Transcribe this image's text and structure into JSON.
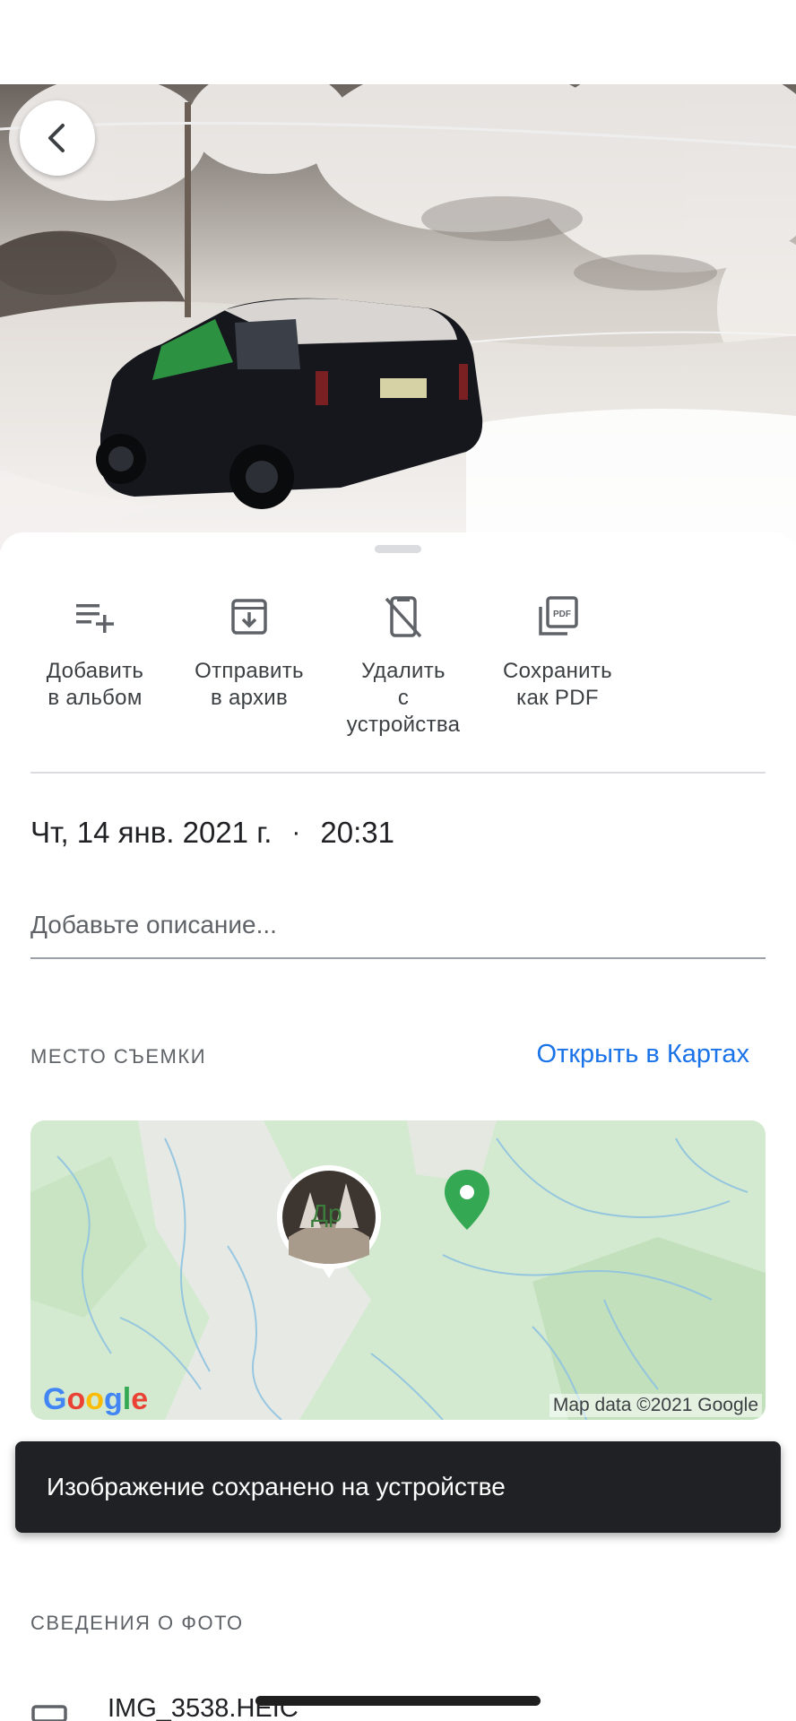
{
  "actions": [
    {
      "label": "Добавить\nв альбом",
      "icon": "playlist-add-icon"
    },
    {
      "label": "Отправить\nв архив",
      "icon": "archive-icon"
    },
    {
      "label": "Удалить\nс\nустройства",
      "icon": "phone-off-icon"
    },
    {
      "label": "Сохранить\nкак PDF",
      "icon": "pdf-icon"
    }
  ],
  "pdf_badge": "PDF",
  "datetime": {
    "date": "Чт, 14 янв. 2021 г.",
    "separator": "·",
    "time": "20:31"
  },
  "description": {
    "placeholder": "Добавьте описание..."
  },
  "location": {
    "section_label": "МЕСТО СЪЕМКИ",
    "open_maps": "Открыть в Картах"
  },
  "map": {
    "place_label": "Др",
    "logo": "Google",
    "attribution": "Map data ©2021 Google"
  },
  "snackbar": {
    "message": "Изображение сохранено на устройстве"
  },
  "details": {
    "section_label": "СВЕДЕНИЯ О ФОТО",
    "file_name": "IMG_3538.HEIC"
  },
  "colors": {
    "accent": "#1a73e8",
    "snackbar_bg": "#202124",
    "map_green": "#34a853"
  }
}
